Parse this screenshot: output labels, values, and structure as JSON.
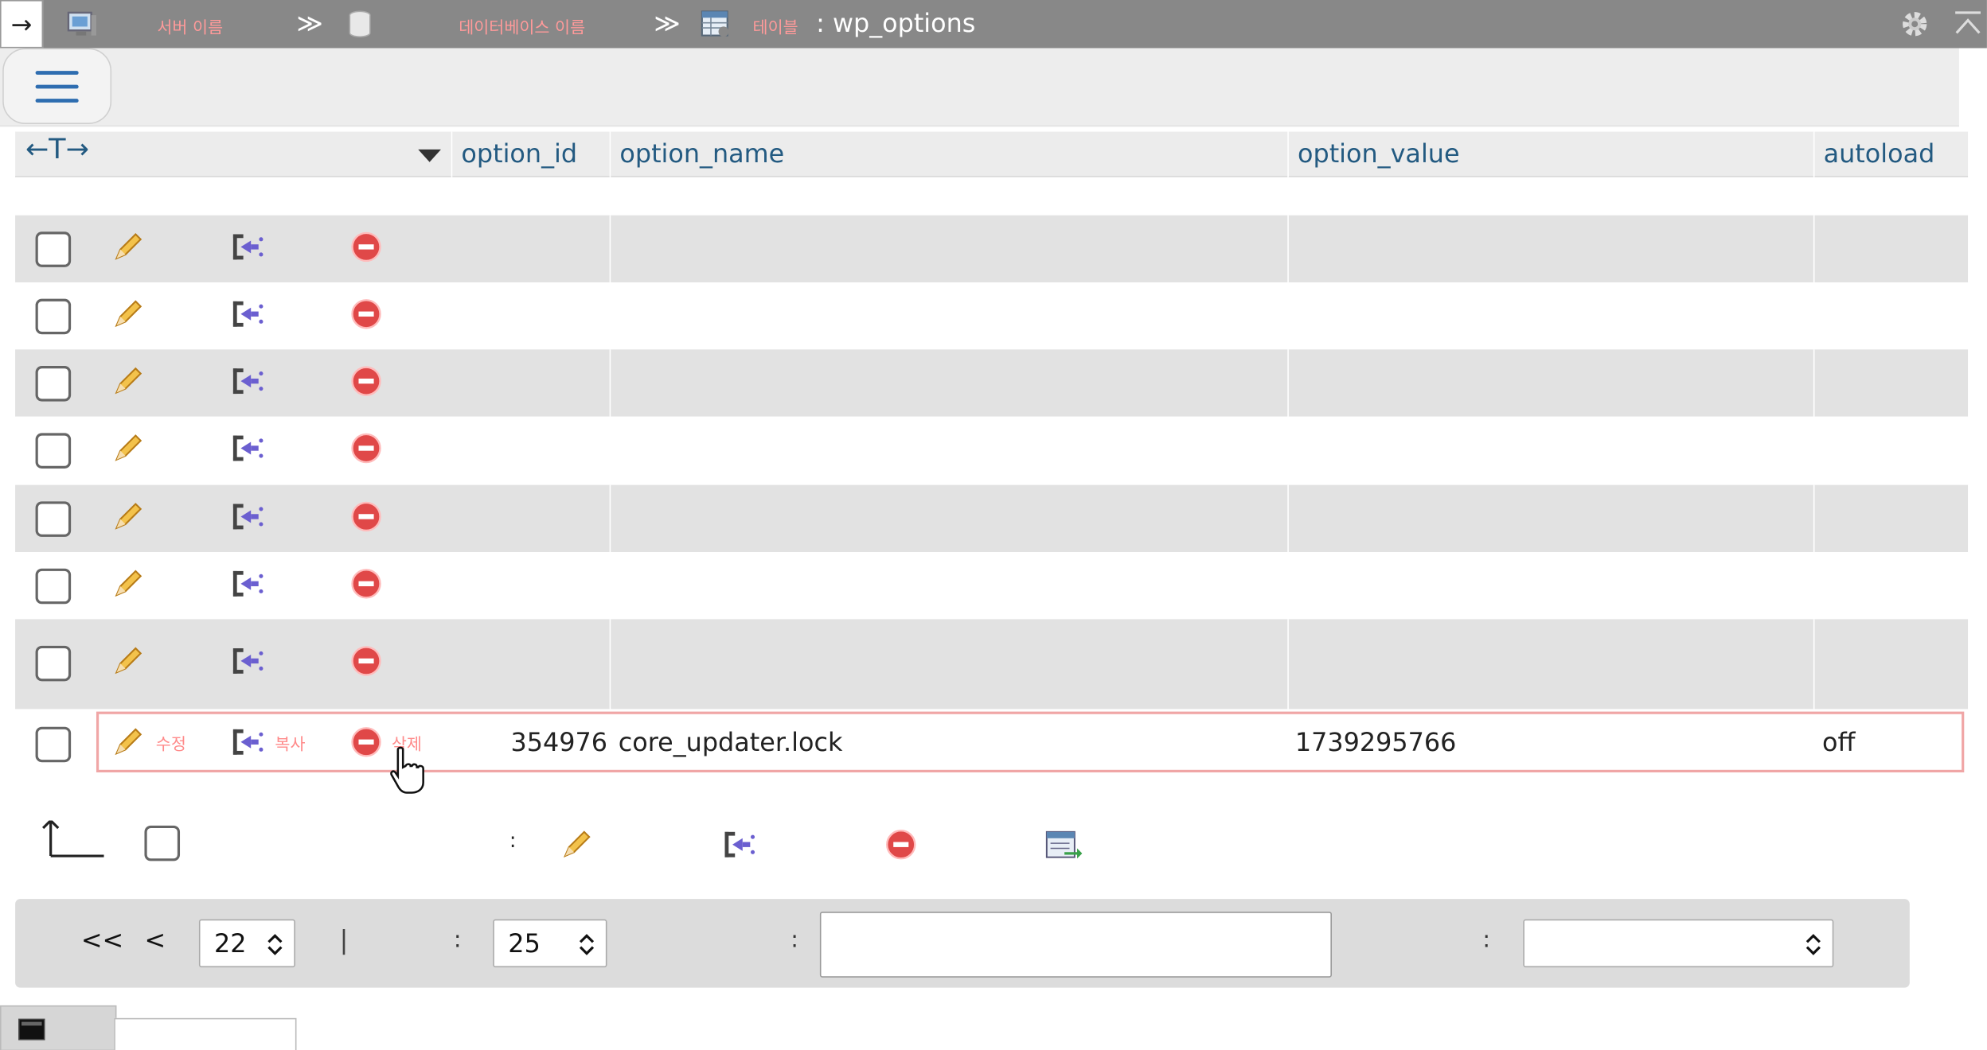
{
  "topbar": {
    "server_label": "서버 이름",
    "database_label": "데이터베이스 이름",
    "table_label": "테이블",
    "table_name": ": wp_options",
    "arrow_glyph": "→",
    "sep_glyph": "≫"
  },
  "table": {
    "headers": [
      "option_id",
      "option_name",
      "option_value",
      "autoload"
    ],
    "resize_arrows": "←T→"
  },
  "rows": [
    {
      "option_id": "",
      "option_name": "",
      "option_value": "",
      "autoload": ""
    },
    {
      "option_id": "",
      "option_name": "",
      "option_value": "",
      "autoload": ""
    },
    {
      "option_id": "",
      "option_name": "",
      "option_value": "",
      "autoload": ""
    },
    {
      "option_id": "",
      "option_name": "",
      "option_value": "",
      "autoload": ""
    },
    {
      "option_id": "",
      "option_name": "",
      "option_value": "",
      "autoload": ""
    },
    {
      "option_id": "",
      "option_name": "",
      "option_value": "",
      "autoload": ""
    },
    {
      "option_id": "",
      "option_name": "",
      "option_value": "",
      "autoload": ""
    }
  ],
  "hovered_row": {
    "edit_label": "수정",
    "copy_label": "복사",
    "delete_label": "삭제",
    "option_id": "354976",
    "option_name": "core_updater.lock",
    "option_value": "1739295766",
    "autoload": "off"
  },
  "bulk": {
    "colon": ":"
  },
  "nav": {
    "first": "<<",
    "prev": "<",
    "page_value": "22",
    "separator": "|",
    "colon1": ":",
    "rows_value": "25",
    "colon2": ":",
    "filter_value": "",
    "colon3": ":",
    "sort_value": ""
  },
  "icons": {
    "edit": "pencil-icon",
    "copy": "copy-icon",
    "delete": "delete-icon",
    "export": "export-icon",
    "settings": "gear-icon",
    "collapse": "collapse-icon"
  }
}
